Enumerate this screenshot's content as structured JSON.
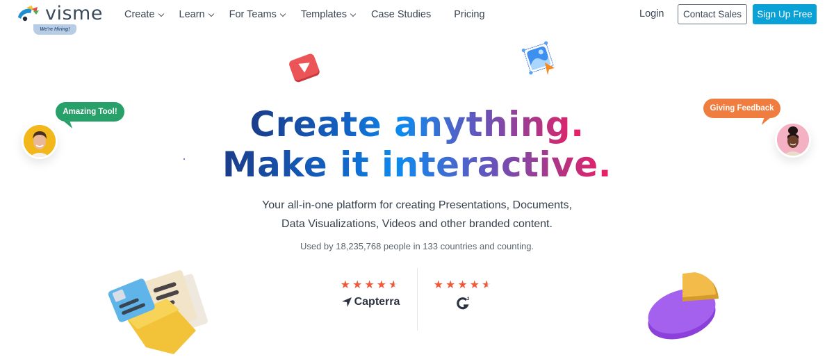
{
  "brand": {
    "name": "visme",
    "hiring_badge": "We're Hiring!"
  },
  "nav": {
    "items": [
      {
        "label": "Create",
        "has_dropdown": true
      },
      {
        "label": "Learn",
        "has_dropdown": true
      },
      {
        "label": "For Teams",
        "has_dropdown": true
      },
      {
        "label": "Templates",
        "has_dropdown": true
      },
      {
        "label": "Case Studies",
        "has_dropdown": false
      },
      {
        "label": "Pricing",
        "has_dropdown": false
      }
    ],
    "login": "Login",
    "contact_sales": "Contact Sales",
    "sign_up": "Sign Up Free"
  },
  "hero": {
    "line1_a": "Create",
    "line1_b": "anything.",
    "line2_a": "Make it",
    "line2_b": "interactive.",
    "subtitle_line1": "Your all-in-one platform for creating Presentations, Documents,",
    "subtitle_line2": "Data Visualizations, Videos and other branded content.",
    "usage": "Used by 18,235,768 people in 133 countries and counting."
  },
  "testimonials": {
    "left_bubble": "Amazing Tool!",
    "right_bubble": "Giving Feedback"
  },
  "ratings": [
    {
      "platform": "Capterra",
      "stars": 4.5,
      "out_of": 5
    },
    {
      "platform": "G2",
      "stars": 4.5,
      "out_of": 5
    }
  ],
  "icons": {
    "video": "play-icon",
    "image": "image-select-icon",
    "folder": "folder-documents-icon",
    "chart": "pie-chart-icon"
  },
  "colors": {
    "primary_button": "#0aa2d6",
    "star": "#ee5a3a",
    "green_bubble": "#27a06a",
    "orange_bubble": "#ee7d3f"
  }
}
